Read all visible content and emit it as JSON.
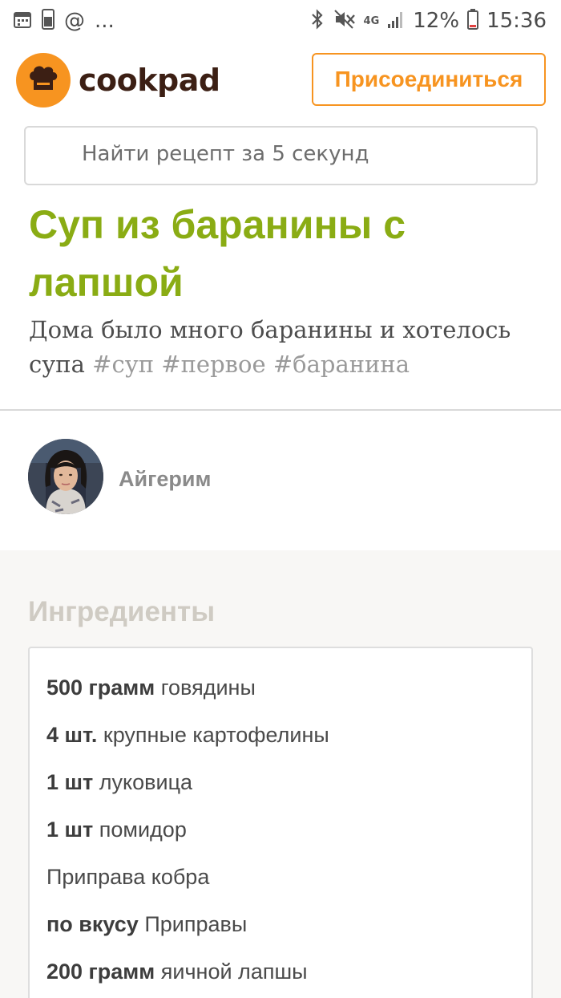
{
  "status_bar": {
    "left_icons": [
      "calendar-icon",
      "phone-icon",
      "at-icon"
    ],
    "ellipsis": "...",
    "network": "4G",
    "battery": "12%",
    "time": "15:36"
  },
  "header": {
    "logo_text": "cookpad",
    "join_label": "Присоединиться"
  },
  "search": {
    "placeholder": "Найти рецепт за 5 секунд"
  },
  "recipe": {
    "title": "Суп из баранины с лапшой",
    "description": "Дома было много баранины и хотелось супа",
    "tags": "#суп #первое #баранина",
    "author": "Айгерим"
  },
  "ingredients": {
    "heading": "Ингредиенты",
    "items": [
      {
        "qty": "500 грамм",
        "name": "говядины"
      },
      {
        "qty": "4 шт.",
        "name": "крупные картофелины"
      },
      {
        "qty": "1 шт",
        "name": "луковица"
      },
      {
        "qty": "1 шт",
        "name": "помидор"
      },
      {
        "qty": "",
        "name": "Приправа кобра"
      },
      {
        "qty": "по вкусу",
        "name": "Приправы"
      },
      {
        "qty": "200 грамм",
        "name": "яичной лапшы"
      }
    ]
  },
  "colors": {
    "brand_orange": "#f79420",
    "title_green": "#8aac14",
    "logo_dark": "#3c1f14"
  }
}
